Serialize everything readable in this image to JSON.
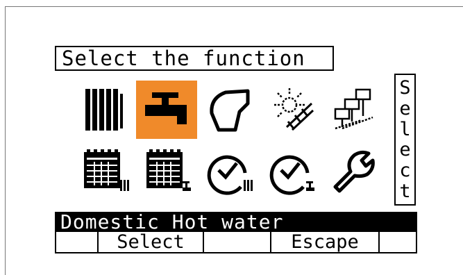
{
  "screen": {
    "title": "Select the function",
    "side_label": "Select",
    "status": "Domestic Hot water",
    "softkeys": [
      "",
      "Select",
      "",
      "Escape",
      ""
    ],
    "accent_color": "#f08a2a",
    "selected_index": 1,
    "icons": [
      "radiator-icon",
      "hot-water-tap-icon",
      "boiler-icon",
      "solar-icon",
      "network-icon",
      "heating-schedule-icon",
      "hot-water-schedule-icon",
      "heating-timer-icon",
      "hot-water-timer-icon",
      "service-wrench-icon"
    ]
  }
}
